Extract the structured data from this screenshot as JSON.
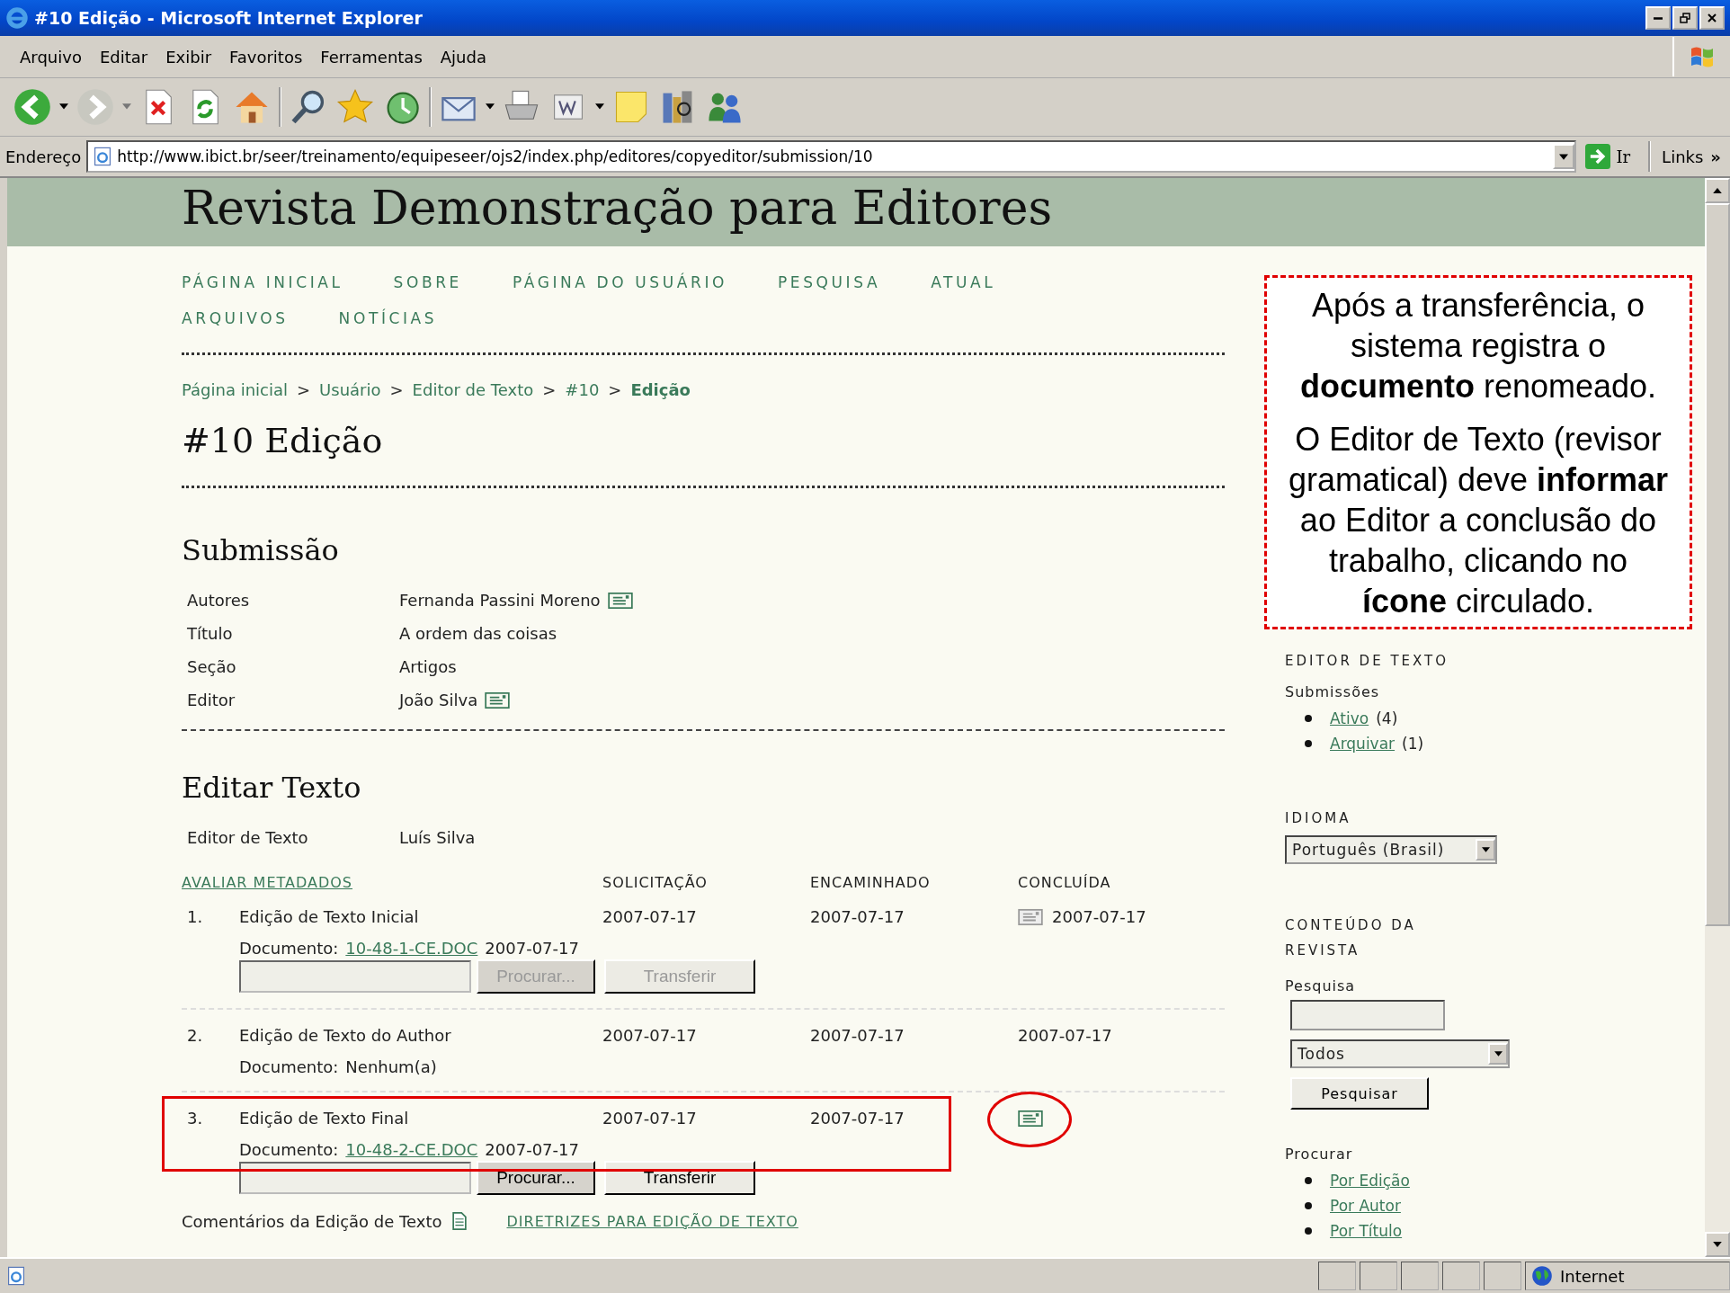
{
  "window": {
    "title": "#10 Edição - Microsoft Internet Explorer"
  },
  "menu": [
    "Arquivo",
    "Editar",
    "Exibir",
    "Favoritos",
    "Ferramentas",
    "Ajuda"
  ],
  "address": {
    "label": "Endereço",
    "url": "http://www.ibict.br/seer/treinamento/equipeseer/ojs2/index.php/editores/copyeditor/submission/10",
    "go": "Ir",
    "links": "Links",
    "links_more": "»"
  },
  "page": {
    "journal_title": "Revista Demonstração para Editores",
    "nav": [
      "PÁGINA INICIAL",
      "SOBRE",
      "PÁGINA DO USUÁRIO",
      "PESQUISA",
      "ATUAL",
      "ARQUIVOS",
      "NOTÍCIAS"
    ],
    "breadcrumb": [
      {
        "label": "Página inicial",
        "current": false
      },
      {
        "sep": ">",
        "label": "Usuário",
        "current": false
      },
      {
        "sep": ">",
        "label": "Editor de Texto",
        "current": false
      },
      {
        "sep": ">",
        "label": "#10",
        "current": false
      },
      {
        "sep": ">",
        "label": "Edição",
        "current": true
      }
    ],
    "heading": "#10 Edição",
    "submission": {
      "title": "Submissão",
      "rows": [
        {
          "label": "Autores",
          "value": "Fernanda Passini Moreno",
          "email": true
        },
        {
          "label": "Título",
          "value": "A ordem das coisas",
          "email": false
        },
        {
          "label": "Seção",
          "value": "Artigos",
          "email": false
        },
        {
          "label": "Editor",
          "value": "João Silva",
          "email": true
        }
      ]
    },
    "copyedit": {
      "title": "Editar Texto",
      "editor_label": "Editor de Texto",
      "editor": "Luís Silva",
      "metadata_link": "AVALIAR METADADOS",
      "columns": [
        "SOLICITAÇÃO",
        "ENCAMINHADO",
        "CONCLUÍDA"
      ],
      "steps": [
        {
          "number": "1.",
          "title": "Edição de Texto Inicial",
          "requested": "2007-07-17",
          "underway": "2007-07-17",
          "notify_enabled": false,
          "completed": "2007-07-17",
          "document": {
            "label": "Documento:",
            "kind": "link",
            "value": "10-48-1-CE.DOC",
            "date": "2007-07-17"
          },
          "upload": {
            "browse": "Procurar...",
            "submit": "Transferir",
            "disabled": true
          },
          "highlighted": false
        },
        {
          "number": "2.",
          "title": "Edição de Texto do Author",
          "requested": "2007-07-17",
          "underway": "2007-07-17",
          "completed": "2007-07-17",
          "document": {
            "label": "Documento:",
            "kind": "text",
            "value": "Nenhum(a)"
          },
          "highlighted": false
        },
        {
          "number": "3.",
          "title": "Edição de Texto Final",
          "requested": "2007-07-17",
          "underway": "2007-07-17",
          "notify_enabled": true,
          "document": {
            "label": "Documento:",
            "kind": "link",
            "value": "10-48-2-CE.DOC",
            "date": "2007-07-17"
          },
          "upload": {
            "browse": "Procurar...",
            "submit": "Transferir",
            "disabled": false
          },
          "highlighted": true
        }
      ],
      "comments_label": "Comentários da Edição de Texto",
      "guidelines_link": "DIRETRIZES PARA EDIÇÃO DE TEXTO"
    }
  },
  "sidebar": {
    "role_title": "EDITOR DE TEXTO",
    "submissions_label": "Submissões",
    "submissions": [
      {
        "link": "Ativo",
        "count": "(4)"
      },
      {
        "link": "Arquivar",
        "count": "(1)"
      }
    ],
    "language_title": "IDIOMA",
    "language": "Português (Brasil)",
    "content_title": "CONTEÚDO DA REVISTA",
    "search_label": "Pesquisa",
    "search_scope": "Todos",
    "search_button": "Pesquisar",
    "browse_label": "Procurar",
    "browse": [
      "Por Edição",
      "Por Autor",
      "Por Título"
    ]
  },
  "annotation": {
    "paragraphs": [
      "Após a transferência, o sistema registra o **documento** renomeado.",
      "O Editor de Texto (revisor gramatical) deve **informar** ao Editor a conclusão do trabalho, clicando no **ícone** circulado."
    ]
  },
  "status_bar": {
    "zone": "Internet"
  }
}
